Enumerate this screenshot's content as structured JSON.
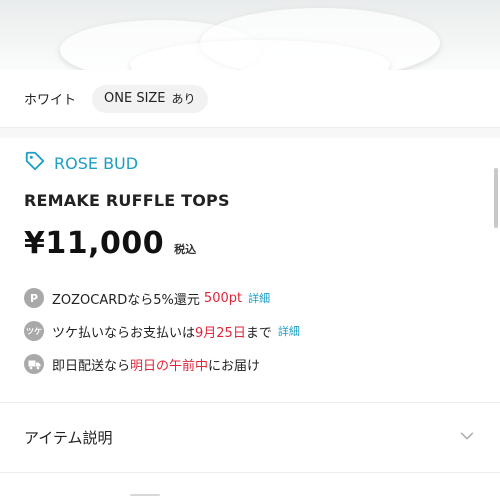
{
  "variant": {
    "color_label": "ホワイト",
    "size_label": "ONE SIZE",
    "stock_label": "あり"
  },
  "brand": {
    "name": "ROSE BUD",
    "icon": "tag-icon",
    "color": "#1d9ec4"
  },
  "product": {
    "name": "REMAKE RUFFLE TOPS",
    "price": "¥11,000",
    "tax_label": "税込"
  },
  "info": {
    "points": {
      "icon_text": "P",
      "text": "ZOZOCARDなら5%還元",
      "points": "500pt",
      "link": "詳細"
    },
    "tsuke": {
      "icon_text": "ツケ",
      "text_before": "ツケ払いならお支払いは",
      "date": "9月25日",
      "text_after": "まで",
      "link": "詳細"
    },
    "delivery": {
      "icon": "truck-icon",
      "text_before": "即日配送なら",
      "highlight": "明日の午前中",
      "text_after": "にお届け"
    }
  },
  "accordion": {
    "title": "アイテム説明",
    "icon": "chevron-down-icon"
  },
  "colors": {
    "accent": "#1d9ec4",
    "highlight_red": "#e0273a"
  }
}
